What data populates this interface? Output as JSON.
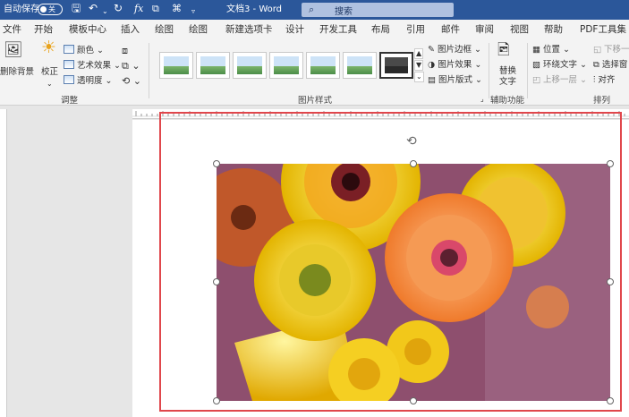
{
  "titlebar": {
    "autosave_label": "自动保存",
    "autosave_state": "关",
    "doc_title": "文档3  -  Word",
    "search_placeholder": "搜索",
    "fx_label": "fx",
    "quick_icons": [
      "save-icon",
      "undo-icon",
      "redo-icon",
      "function-icon",
      "touch-mode-icon",
      "org-chart-icon",
      "customize-icon"
    ]
  },
  "tabs": [
    "文件",
    "开始",
    "模板中心",
    "插入",
    "绘图",
    "绘图",
    "新建选项卡",
    "设计",
    "开发工具",
    "布局",
    "引用",
    "邮件",
    "审阅",
    "视图",
    "帮助",
    "PDF工具集"
  ],
  "ribbon": {
    "adjust": {
      "remove_bg": "删除背景",
      "correct": "校正",
      "color": "颜色",
      "art_effects": "艺术效果",
      "transparency": "透明度",
      "group_label": "调整"
    },
    "picture_styles": {
      "border": "图片边框",
      "effects": "图片效果",
      "layout": "图片版式",
      "group_label": "图片样式"
    },
    "accessibility": {
      "alt_text_line1": "替换",
      "alt_text_line2": "文字",
      "group_label": "辅助功能"
    },
    "arrange": {
      "position": "位置",
      "wrap_text": "环绕文字",
      "bring_forward": "上移一层",
      "send_backward": "下移一",
      "selection_pane": "选择窗",
      "align": "对齐",
      "group_label": "排列"
    }
  },
  "colors": {
    "title_bar": "#2b579a",
    "selection_box": "#e0474c",
    "ribbon_bg": "#f3f3f3"
  }
}
